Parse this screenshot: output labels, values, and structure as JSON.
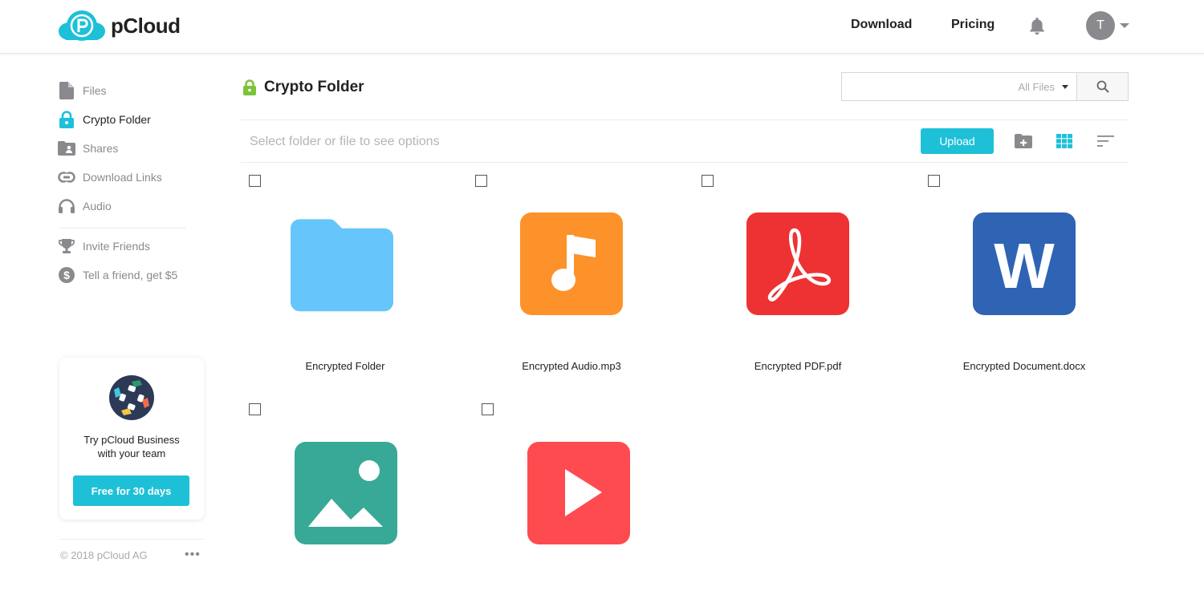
{
  "app": {
    "brand": "pCloud",
    "brand_color": "#1ec0d8"
  },
  "header": {
    "nav": [
      {
        "label": "Download"
      },
      {
        "label": "Pricing"
      }
    ],
    "notifications_icon": "bell-icon",
    "user": {
      "initial": "T",
      "menu_icon": "caret-down-icon"
    }
  },
  "sidebar": {
    "items": [
      {
        "label": "Files",
        "icon": "file-icon",
        "active": false
      },
      {
        "label": "Crypto Folder",
        "icon": "lock-icon",
        "active": true
      },
      {
        "label": "Shares",
        "icon": "shared-folder-icon",
        "active": false
      },
      {
        "label": "Download Links",
        "icon": "link-icon",
        "active": false
      },
      {
        "label": "Audio",
        "icon": "headphones-icon",
        "active": false
      }
    ],
    "secondary": [
      {
        "label": "Invite Friends",
        "icon": "trophy-icon"
      },
      {
        "label": "Tell a friend, get $5",
        "icon": "dollar-icon"
      }
    ],
    "promo": {
      "text_line1": "Try pCloud Business",
      "text_line2": "with your team",
      "button_label": "Free for 30 days"
    },
    "footer": {
      "copyright": "© 2018 pCloud AG",
      "more_label": "•••"
    }
  },
  "main": {
    "title": "Crypto Folder",
    "search": {
      "value": "",
      "placeholder": "",
      "filter_selected": "All Files"
    },
    "toolbar": {
      "hint": "Select folder or file to see options",
      "upload_label": "Upload",
      "new_folder_icon": "new-folder-icon",
      "grid_view_icon": "grid-view-icon",
      "sort_icon": "sort-icon"
    },
    "items": [
      {
        "name": "Encrypted Folder",
        "type": "folder",
        "color": "#66c6fb",
        "checked": false
      },
      {
        "name": "Encrypted Audio.mp3",
        "type": "audio",
        "color": "#fd922a",
        "checked": false
      },
      {
        "name": "Encrypted PDF.pdf",
        "type": "pdf",
        "color": "#ee3233",
        "checked": false
      },
      {
        "name": "Encrypted Document.docx",
        "type": "document",
        "color": "#2f63b3",
        "checked": false
      },
      {
        "name": "",
        "type": "image",
        "color": "#38a897",
        "checked": false
      },
      {
        "name": "",
        "type": "video",
        "color": "#fe4b50",
        "checked": false
      }
    ]
  }
}
